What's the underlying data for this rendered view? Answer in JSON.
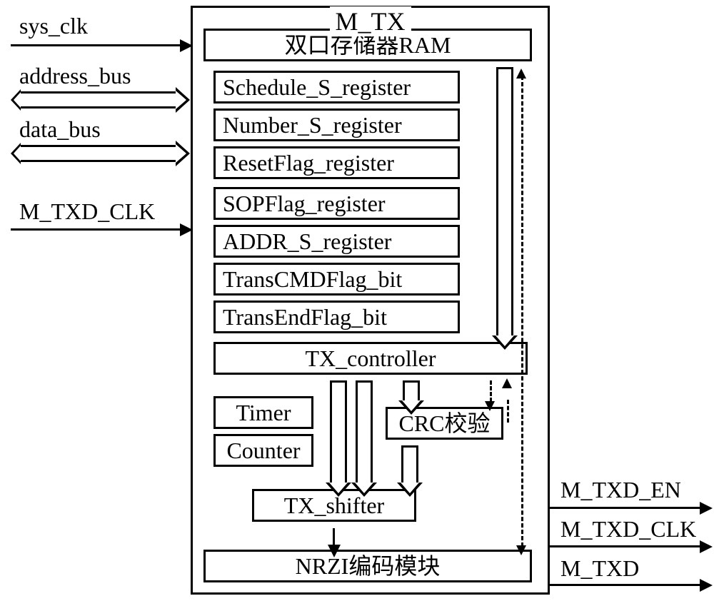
{
  "diagram": {
    "block_title": "M_TX",
    "inputs": {
      "sys_clk": "sys_clk",
      "address_bus": "address_bus",
      "data_bus": "data_bus",
      "m_txd_clk": "M_TXD_CLK"
    },
    "outputs": {
      "m_txd_en": "M_TXD_EN",
      "m_txd_clk": "M_TXD_CLK",
      "m_txd": "M_TXD"
    },
    "components": {
      "ram": "双口存储器RAM",
      "reg1": "Schedule_S_register",
      "reg2": "Number_S_register",
      "reg3": "ResetFlag_register",
      "reg4": "SOPFlag_register",
      "reg5": "ADDR_S_register",
      "reg6": "TransCMDFlag_bit",
      "reg7": "TransEndFlag_bit",
      "tx_controller": "TX_controller",
      "timer": "Timer",
      "counter": "Counter",
      "crc": "CRC校验",
      "tx_shifter": "TX_shifter",
      "nrzi": "NRZI编码模块"
    }
  }
}
